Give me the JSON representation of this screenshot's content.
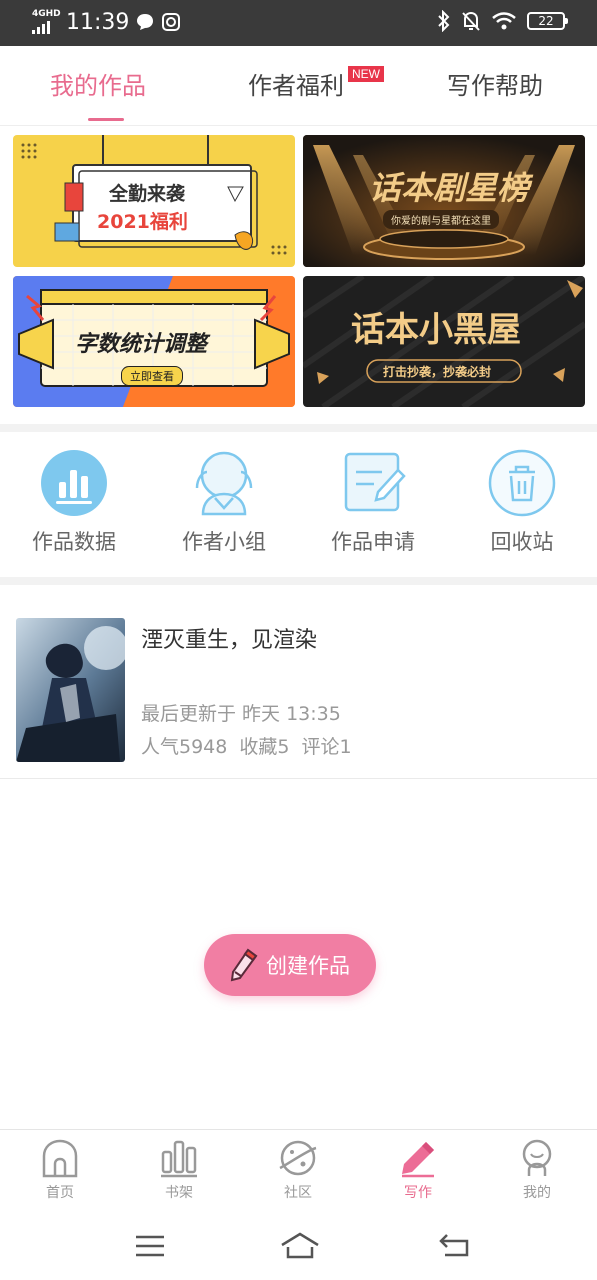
{
  "status_bar": {
    "network": "4GHD",
    "time": "11:39",
    "battery": "22"
  },
  "tabs": [
    {
      "label": "我的作品",
      "active": true
    },
    {
      "label": "作者福利",
      "badge": "NEW"
    },
    {
      "label": "写作帮助"
    }
  ],
  "banners": [
    {
      "title_line1": "全勤来袭",
      "title_line2": "2021福利"
    },
    {
      "title": "话本剧星榜",
      "subtitle": "你爱的剧与星都在这里"
    },
    {
      "title": "字数统计调整",
      "button": "立即查看"
    },
    {
      "title": "话本小黑屋",
      "subtitle": "打击抄袭，抄袭必封"
    }
  ],
  "quick_menu": [
    {
      "label": "作品数据",
      "icon": "bar-chart-icon"
    },
    {
      "label": "作者小组",
      "icon": "group-icon"
    },
    {
      "label": "作品申请",
      "icon": "edit-document-icon"
    },
    {
      "label": "回收站",
      "icon": "trash-icon"
    }
  ],
  "work": {
    "title": "湮灭重生，见渲染",
    "updated": "最后更新于 昨天 13:35",
    "popularity": "人气5948",
    "favorites": "收藏5",
    "comments": "评论1"
  },
  "create_button": {
    "label": "创建作品"
  },
  "bottom_nav": [
    {
      "label": "首页",
      "icon": "home-icon"
    },
    {
      "label": "书架",
      "icon": "bookshelf-icon"
    },
    {
      "label": "社区",
      "icon": "planet-icon"
    },
    {
      "label": "写作",
      "icon": "pen-icon",
      "active": true
    },
    {
      "label": "我的",
      "icon": "profile-icon"
    }
  ],
  "colors": {
    "accent": "#e86b8e",
    "create_button": "#f17ea3",
    "icon_blue": "#7ec8ee",
    "new_badge": "#e8354a"
  }
}
